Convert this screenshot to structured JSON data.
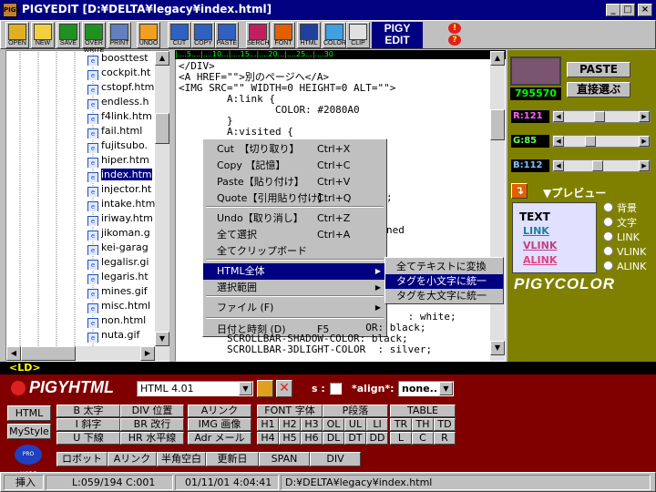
{
  "window": {
    "title": "PIGYEDIT  [D:¥DELTA¥legacy¥index.html]",
    "app_icon": "PIGY",
    "minimize": "_",
    "maximize": "□",
    "close": "×"
  },
  "toolbar": [
    {
      "label": "OPEN",
      "icon": "folder-icon",
      "color": "#e0b020"
    },
    {
      "label": "NEW",
      "icon": "new-file-icon",
      "color": "#f0d040"
    },
    {
      "label": "SAVE",
      "icon": "save-icon",
      "color": "#209020"
    },
    {
      "label": "OVER WRITE",
      "icon": "overwrite-icon",
      "color": "#209020"
    },
    {
      "label": "PRINT",
      "icon": "print-icon",
      "color": "#6080c0"
    },
    {
      "label": "UNDO",
      "icon": "undo-icon",
      "color": "#f0a020"
    },
    {
      "label": "CUT",
      "icon": "cut-icon",
      "color": "#3060c0"
    },
    {
      "label": "COPY",
      "icon": "copy-icon",
      "color": "#3060c0"
    },
    {
      "label": "PASTE",
      "icon": "paste-icon",
      "color": "#3060c0"
    },
    {
      "label": "SERCH",
      "icon": "search-icon",
      "color": "#c02060"
    },
    {
      "label": "FONT",
      "icon": "font-icon",
      "color": "#e06000"
    },
    {
      "label": "HTML",
      "icon": "globe-icon",
      "color": "#2040a0"
    },
    {
      "label": "COLOR",
      "icon": "rainbow-icon",
      "color": "#40a0e0"
    },
    {
      "label": "CLIP",
      "icon": "clipboard-icon",
      "color": "#e0e0e0"
    },
    {
      "label": "FILE",
      "icon": "file-icon",
      "color": "#80a0d0"
    }
  ],
  "brand": {
    "line1": "PIGY",
    "line2": "EDIT"
  },
  "file_tree": [
    "boosttest",
    "cockpit.ht",
    "cstopf.htm",
    "endless.h",
    "f4link.htm",
    "fail.html",
    "fujitsubo.",
    "hiper.htm",
    "index.htm",
    "injector.ht",
    "intake.htm",
    "iriway.htm",
    "jikoman.g",
    "kei-garag",
    "legalisr.gi",
    "legaris.ht",
    "mines.gif",
    "misc.html",
    "non.html",
    "nuta.gif"
  ],
  "file_tree_selected": 8,
  "ruler": "|....5....|....10...|....15...|....20...|....25...|....30",
  "editor_lines": [
    "</DIV>",
    "<A HREF=\"\">別のページへ</A>",
    "<IMG SRC=\"\" WIDTH=0 HEIGHT=0 ALT=\"\">",
    "        A:link {",
    "                COLOR: #2080A0",
    "        }",
    "        A:visited {"
  ],
  "editor_visible_tails": [
    {
      "text": ";",
      "row": 12
    },
    {
      "text": "ned",
      "row": 15
    }
  ],
  "editor_lines_bottom": [
    "                                      : white;",
    "                               OR: black;",
    "        SCROLLBAR-SHADOW-COLOR: black;",
    "        SCROLLBAR-3DLIGHT-COLOR  : silver;"
  ],
  "context_menu": {
    "items": [
      {
        "label": "Cut　【切り取り】",
        "shortcut": "Ctrl+X"
      },
      {
        "label": "Copy 【記憶】",
        "shortcut": "Ctrl+C"
      },
      {
        "label": "Paste【貼り付け】",
        "shortcut": "Ctrl+V"
      },
      {
        "label": "Quote【引用貼り付け】",
        "shortcut": "Ctrl+Q"
      },
      {
        "label": "Undo【取り消し】",
        "shortcut": "Ctrl+Z"
      },
      {
        "label": "全て選択",
        "shortcut": "Ctrl+A"
      },
      {
        "label": "全てクリップボード",
        "shortcut": ""
      },
      {
        "label": "HTML全体",
        "shortcut": "",
        "submenu": true
      },
      {
        "label": "選択範囲",
        "shortcut": "",
        "submenu": true
      },
      {
        "label": "ファイル (F)",
        "shortcut": "",
        "submenu": true
      },
      {
        "label": "日付と時刻 (D)",
        "shortcut": "F5"
      }
    ],
    "highlighted": 7
  },
  "submenu": {
    "items": [
      "全てテキストに変換",
      "タグを小文字に統一",
      "タグを大文字に統一"
    ],
    "highlighted": 1
  },
  "color_panel": {
    "current_color": "#795570",
    "hex": "795570",
    "paste_button": "PASTE",
    "direct_button": "直接選ぶ",
    "sliders": [
      {
        "label": "R:121",
        "value": 121,
        "color": "#ff60ff"
      },
      {
        "label": "G:85",
        "value": 85,
        "color": "#60ff60"
      },
      {
        "label": "B:112",
        "value": 112,
        "color": "#80c0ff"
      }
    ],
    "preview_title": "▼プレビュー",
    "preview": {
      "text": "TEXT",
      "link": "LINK",
      "vlink": "VLINK",
      "alink": "ALINK",
      "link_color": "#2080A0",
      "vlink_color": "#c04080",
      "alink_color": "#e04080"
    },
    "radio_options": [
      "背景",
      "文字",
      "LINK",
      "VLINK",
      "ALINK"
    ],
    "logo": "PIGYCOLOR"
  },
  "lbar": "<LD>",
  "html_panel": {
    "logo": "PIGYHTML",
    "version_select": "HTML 4.01",
    "s_label": "s :",
    "align_label": "*align*:",
    "align_select": "none..",
    "side_buttons": [
      "HTML",
      "MyStyle"
    ],
    "tag_groups": [
      [
        "B 太字",
        "I 斜字",
        "U 下線"
      ],
      [
        "DIV 位置",
        "BR 改行",
        "HR 水平線"
      ],
      [
        "Aリンク",
        "IMG 画像",
        "Adr メール"
      ],
      [
        "FONT 字体"
      ],
      [
        "P段落"
      ],
      [
        "TABLE"
      ]
    ],
    "heading_buttons": [
      "H1",
      "H2",
      "H3",
      "H4",
      "H5",
      "H6"
    ],
    "list_buttons": [
      "OL",
      "UL",
      "LI",
      "DL",
      "DT",
      "DD"
    ],
    "table_buttons": [
      "TR",
      "TH",
      "TD",
      "L",
      "C",
      "R"
    ],
    "bottom_row": [
      "ロボット",
      "Aリンク",
      "半角空白",
      "更新日",
      "SPAN",
      "DIV"
    ],
    "pro_label": "PRO MODE"
  },
  "status": {
    "mode": "挿入",
    "position": "L:059/194  C:001",
    "datetime": "01/11/01  4:04:41",
    "path": "D:¥DELTA¥legacy¥index.html"
  }
}
